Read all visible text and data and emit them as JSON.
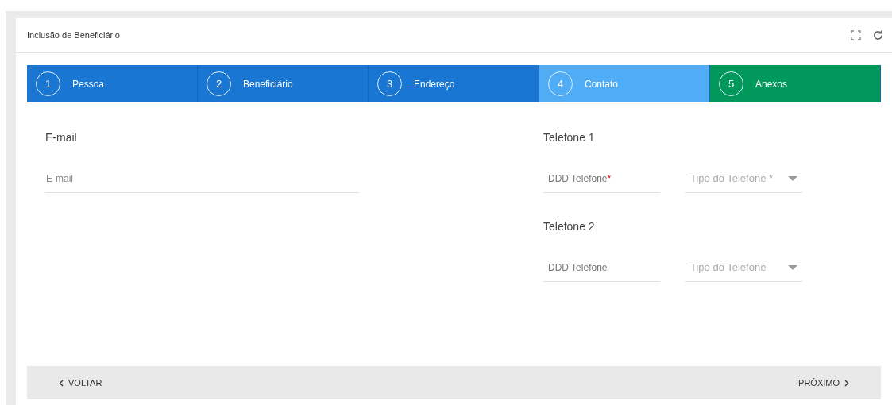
{
  "panel": {
    "title": "Inclusão de Beneficiário"
  },
  "steps": [
    {
      "number": "1",
      "label": "Pessoa",
      "color": "#1976d2"
    },
    {
      "number": "2",
      "label": "Beneficiário",
      "color": "#1976d2"
    },
    {
      "number": "3",
      "label": "Endereço",
      "color": "#1976d2"
    },
    {
      "number": "4",
      "label": "Contato",
      "color": "#50acf5"
    },
    {
      "number": "5",
      "label": "Anexos",
      "color": "#00985b"
    }
  ],
  "email_section": {
    "heading": "E-mail",
    "field": {
      "placeholder": "E-mail"
    }
  },
  "phone_sections": [
    {
      "heading": "Telefone 1",
      "fields": [
        {
          "kind": "text",
          "placeholder": "DDD Telefone",
          "required_mark": "*"
        },
        {
          "kind": "select",
          "placeholder": "Tipo do Telefone *"
        }
      ]
    },
    {
      "heading": "Telefone 2",
      "fields": [
        {
          "kind": "text",
          "placeholder": "DDD Telefone"
        },
        {
          "kind": "select",
          "placeholder": "Tipo do Telefone"
        }
      ]
    }
  ],
  "footer": {
    "back": "VOLTAR",
    "next": "PRÓXIMO"
  }
}
